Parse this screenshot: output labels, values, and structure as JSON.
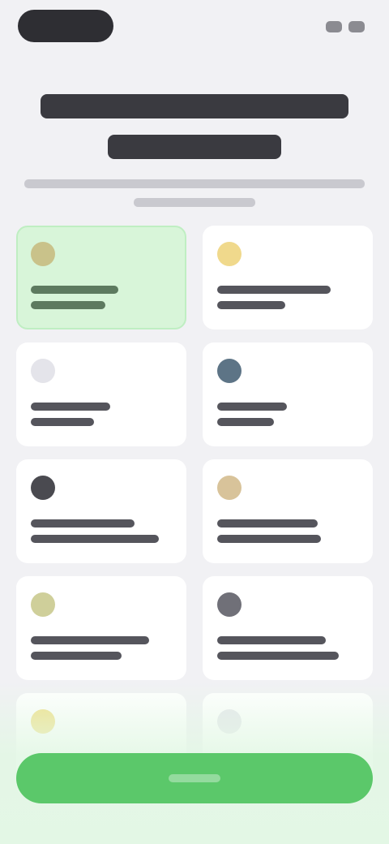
{
  "header": {
    "title": "",
    "subtitle": ""
  },
  "colors": {
    "accent": "#5bc86a",
    "selected_card": "#d8f5d9",
    "card": "#ffffff",
    "background": "#f1f1f4"
  },
  "options": [
    {
      "label": "",
      "icon": "leaf-icon",
      "icon_color": "#c9c28a",
      "selected": true
    },
    {
      "label": "",
      "icon": "sun-icon",
      "icon_color": "#f0d98c",
      "selected": false
    },
    {
      "label": "",
      "icon": "drop-icon",
      "icon_color": "#e4e4ea",
      "selected": false
    },
    {
      "label": "",
      "icon": "globe-icon",
      "icon_color": "#5d7486",
      "selected": false
    },
    {
      "label": "",
      "icon": "chat-icon",
      "icon_color": "#4a4a50",
      "selected": false
    },
    {
      "label": "",
      "icon": "star-icon",
      "icon_color": "#d8c39a",
      "selected": false
    },
    {
      "label": "",
      "icon": "bolt-icon",
      "icon_color": "#cfcf9a",
      "selected": false
    },
    {
      "label": "",
      "icon": "lock-icon",
      "icon_color": "#707078",
      "selected": false
    },
    {
      "label": "",
      "icon": "flower-icon",
      "icon_color": "#f0df86",
      "selected": false
    },
    {
      "label": "",
      "icon": "heart-icon",
      "icon_color": "#e6e6ec",
      "selected": false
    }
  ],
  "footer": {
    "continue_label": ""
  }
}
